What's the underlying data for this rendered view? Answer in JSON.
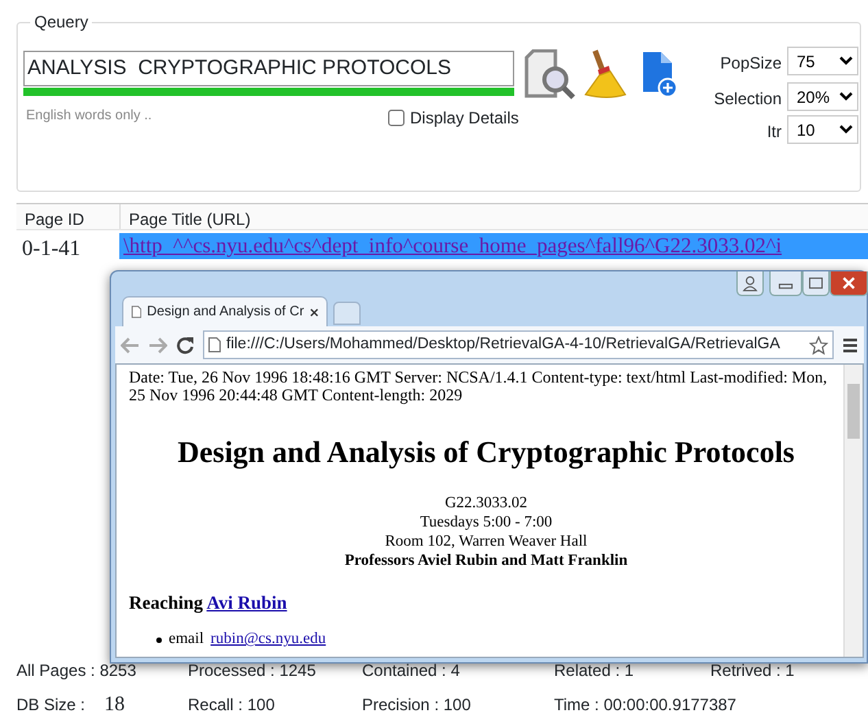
{
  "query": {
    "legend": "Qeuery",
    "text": "ANALYSIS  CRYPTOGRAPHIC PROTOCOLS",
    "level": 1,
    "hint": "English words only ..",
    "display_details": {
      "label": "Display Details",
      "checked": false
    },
    "options": [
      {
        "label": "PopSize",
        "value": "75"
      },
      {
        "label": "Selection",
        "value": "20%"
      },
      {
        "label": "Itr",
        "value": "10"
      }
    ]
  },
  "table": {
    "columns": [
      "Page ID",
      "Page Title (URL)"
    ],
    "rows": [
      {
        "page_id": "0-1-41",
        "url": "\\http_^^cs.nyu.edu^cs^dept_info^course_home_pages^fall96^G22.3033.02^i",
        "selected": true
      }
    ]
  },
  "browser": {
    "tab_title": "Design and Analysis of Cr",
    "address": "file:///C:/Users/Mohammed/Desktop/RetrievalGA-4-10/RetrievalGA/RetrievalGA",
    "header_text": "Date: Tue, 26 Nov 1996 18:48:16 GMT Server: NCSA/1.4.1 Content-type: text/html Last-modified: Mon, 25 Nov 1996 20:44:48 GMT Content-length: 2029",
    "heading": "Design and Analysis of Cryptographic Protocols",
    "lines": [
      "G22.3033.02",
      "Tuesdays 5:00 - 7:00",
      "Room 102, Warren Weaver Hall"
    ],
    "professors": "Professors Aviel Rubin and Matt Franklin",
    "reaching": "Reaching",
    "reaching_link": "Avi Rubin",
    "bullet": {
      "label": "email",
      "link": "rubin@cs.nyu.edu"
    }
  },
  "stats": [
    {
      "label": "All Pages : 8253"
    },
    {
      "label": "Processed : 1245"
    },
    {
      "label": "Contained : 4"
    },
    {
      "label": "Related : 1"
    },
    {
      "label": "Retrived : 1"
    },
    {
      "label": "DB Size :",
      "value": "18"
    },
    {
      "label": "Recall : 100"
    },
    {
      "label": "Precision : 100"
    },
    {
      "label": "Time : 00:00:00.9177387"
    }
  ]
}
